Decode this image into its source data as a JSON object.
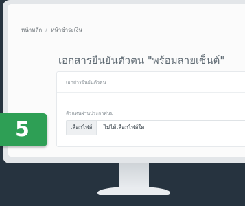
{
  "breadcrumb": {
    "home": "หน้าหลัก",
    "separator": "/",
    "current": "หน้าชำระเงิน"
  },
  "page": {
    "title": "เอกสารยืนยันตัวตน \"พร้อมลายเซ็นต์\""
  },
  "card": {
    "header": "เอกสารยืนยันตัวตน",
    "field_label": "ตัวแทนผ่านประกาศนม",
    "choose_file_button": "เลือกไฟล์",
    "file_name": "ไม่ได้เลือกไฟล์ใด"
  },
  "step": {
    "number": "5"
  },
  "colors": {
    "background": "#26333f",
    "badge": "#2e9f55",
    "monitor": "#e3e6e9"
  }
}
